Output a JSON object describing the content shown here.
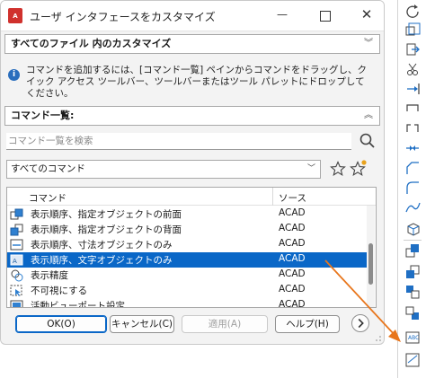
{
  "window": {
    "app_icon_text": "A",
    "title": "ユーザ インタフェースをカスタマイズ",
    "minimize_glyph": "—",
    "close_glyph": "✕"
  },
  "customize_section": {
    "title": "すべてのファイル 内のカスタマイズ",
    "collapse_glyph": "︾"
  },
  "info": {
    "icon_text": "i",
    "text": "コマンドを追加するには、[コマンド一覧] ペインからコマンドをドラッグし、クイック アクセス ツールバー、ツールバーまたはツール パレットにドロップしてください。"
  },
  "command_list_section": {
    "title": "コマンド一覧:",
    "collapse_glyph": "︽"
  },
  "search": {
    "placeholder": "コマンド一覧を検索",
    "value": ""
  },
  "filter": {
    "selected": "すべてのコマンド",
    "dropdown_glyph": "﹀"
  },
  "table": {
    "columns": [
      "コマンド",
      "ソース"
    ],
    "rows": [
      {
        "icon": "draworder-front-icon",
        "command": "表示順序、指定オブジェクトの前面",
        "source": "ACAD"
      },
      {
        "icon": "draworder-back-icon",
        "command": "表示順序、指定オブジェクトの背面",
        "source": "ACAD"
      },
      {
        "icon": "draworder-dim-icon",
        "command": "表示順序、寸法オブジェクトのみ",
        "source": "ACAD"
      },
      {
        "icon": "draworder-text-icon",
        "command": "表示順序、文字オブジェクトのみ",
        "source": "ACAD",
        "selected": true
      },
      {
        "icon": "display-precision-icon",
        "command": "表示精度",
        "source": "ACAD"
      },
      {
        "icon": "hide-objects-icon",
        "command": "不可視にする",
        "source": "ACAD"
      },
      {
        "icon": "active-viewport-icon",
        "command": "活動ビューポート設定",
        "source": "ACAD"
      }
    ]
  },
  "buttons": {
    "ok": "OK(O)",
    "cancel": "キャンセル(C)",
    "apply": "適用(A)",
    "help": "ヘルプ(H)"
  },
  "colors": {
    "selection": "#0a67c7",
    "drag_arrow": "#e8761c",
    "app_icon": "#d0312d",
    "toolbar_icon": "#1f6fc4"
  },
  "toolbar_icons": [
    "rotate-icon",
    "scale-icon",
    "stretch-icon",
    "trim-icon",
    "extend-icon",
    "break-at-point-icon",
    "break-icon",
    "join-icon",
    "chamfer-icon",
    "fillet-icon",
    "blend-curves-icon",
    "explode-icon",
    "draworder-front-icon",
    "draworder-back-icon",
    "draworder-above-icon",
    "draworder-below-icon",
    "draworder-text-icon",
    "draworder-dim-icon"
  ]
}
